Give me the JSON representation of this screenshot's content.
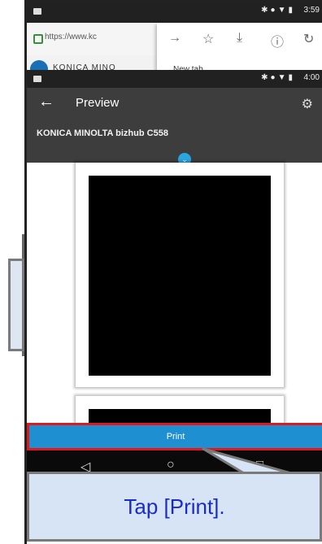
{
  "back_browser": {
    "status_time": "3:59",
    "url": "https://www.kc",
    "menu_icons": [
      "arrow-right-icon",
      "star-icon",
      "download-icon",
      "info-icon",
      "refresh-icon"
    ],
    "new_tab_label": "New tab",
    "site_name": "KONICA MINO"
  },
  "front_app": {
    "status_time": "4:00",
    "title": "Preview",
    "printer_name": "KONICA MINOLTA bizhub C558",
    "print_label": "Print",
    "nav_icons": [
      "nav-back-icon",
      "nav-home-icon",
      "nav-recent-icon"
    ]
  },
  "callout": {
    "text": "Tap [Print]."
  },
  "colors": {
    "appbar": "#3d3d3d",
    "print_button": "#1e8fd0",
    "highlight_border": "#e0181b",
    "callout_bg": "#d6e4f5",
    "callout_text": "#1a2cc8"
  }
}
